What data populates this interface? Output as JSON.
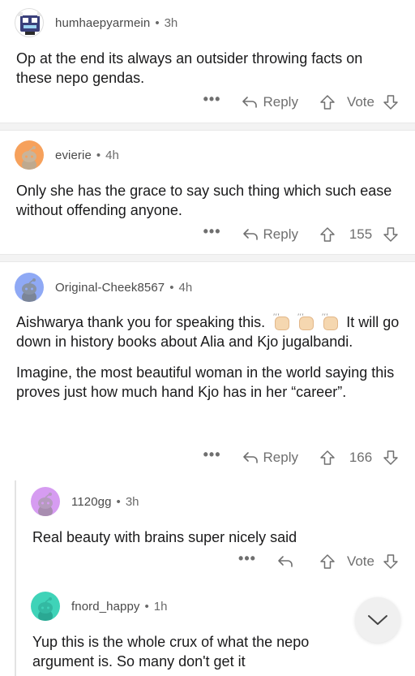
{
  "comments": [
    {
      "author": "humhaepyarmein",
      "time": "3h",
      "body": [
        "Op at the end its always an outsider throwing facts on these nepo gendas."
      ],
      "reply_label": "Reply",
      "score": "Vote",
      "avatar_color": "#ffffff"
    },
    {
      "author": "evierie",
      "time": "4h",
      "body": [
        "Only she has the grace to say such thing which such ease without offending anyone."
      ],
      "reply_label": "Reply",
      "score": "155",
      "avatar_color": "#f6a15c"
    },
    {
      "author": "Original-Cheek8567",
      "time": "4h",
      "body_line1_before": "Aishwarya thank you for speaking this.",
      "body_line1_after": "It",
      "body_rest": "will go down in history books about Alia and Kjo jugalbandi.",
      "body_p2": "Imagine, the most beautiful woman in the world saying this proves just how much hand Kjo has in her “career”.",
      "reply_label": "Reply",
      "score": "166",
      "avatar_color": "#8fa9f5"
    },
    {
      "author": "1120gg",
      "time": "3h",
      "body": [
        "Real beauty with brains super nicely said"
      ],
      "score": "Vote",
      "avatar_color": "#d69cf1"
    },
    {
      "author": "fnord_happy",
      "time": "1h",
      "body": [
        "Yup this is the whole crux of what the nepo argument is. So many don't get it"
      ],
      "avatar_color": "#3fd3b8"
    }
  ],
  "meta_separator": "•",
  "more_label": "•••"
}
